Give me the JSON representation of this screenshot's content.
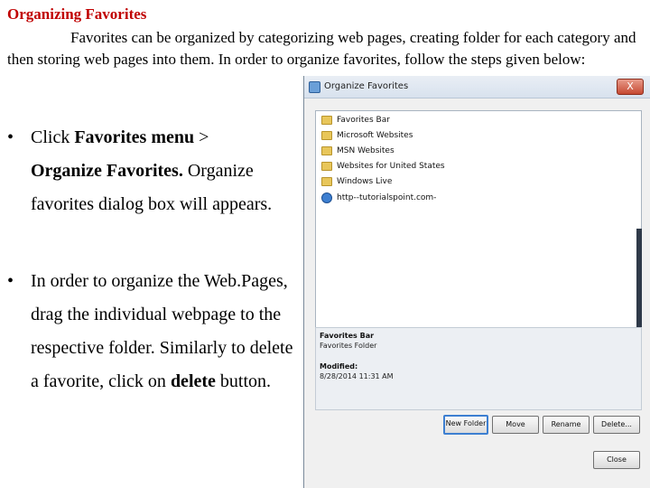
{
  "heading": "Organizing Favorites",
  "intro": "Favorites can be organized by categorizing web pages, creating folder for each category and then storing web pages into them. In order to organize favorites, follow the steps given below:",
  "bullets": [
    {
      "marker": "•",
      "pre": "Click ",
      "bold1": "Favorites menu",
      "mid": " > ",
      "bold2": "Organize Favorites.",
      "post": " Organize favorites dialog box will appears."
    },
    {
      "marker": "•",
      "pre": "In order to organize the Web.Pages, drag the individual webpage to the respective folder. Similarly to delete a favorite, click on ",
      "bold1": "delete",
      "post": " button."
    }
  ],
  "dialog": {
    "title": "Organize Favorites",
    "close_label": "X",
    "tree": [
      {
        "label": "Favorites Bar",
        "icon": "folder-icon"
      },
      {
        "label": "Microsoft Websites",
        "icon": "folder-icon"
      },
      {
        "label": "MSN Websites",
        "icon": "folder-icon"
      },
      {
        "label": "Websites for United States",
        "icon": "folder-icon"
      },
      {
        "label": "Windows Live",
        "icon": "folder-icon"
      },
      {
        "label": "http--tutorialspoint.com-",
        "icon": "ie-page-icon"
      }
    ],
    "info": {
      "name": "Favorites Bar",
      "type": "Favorites Folder",
      "modified_label": "Modified:",
      "modified_value": "8/28/2014 11:31 AM"
    },
    "buttons": {
      "new_folder": "New Folder",
      "move": "Move",
      "rename": "Rename",
      "delete": "Delete...",
      "close": "Close"
    }
  }
}
